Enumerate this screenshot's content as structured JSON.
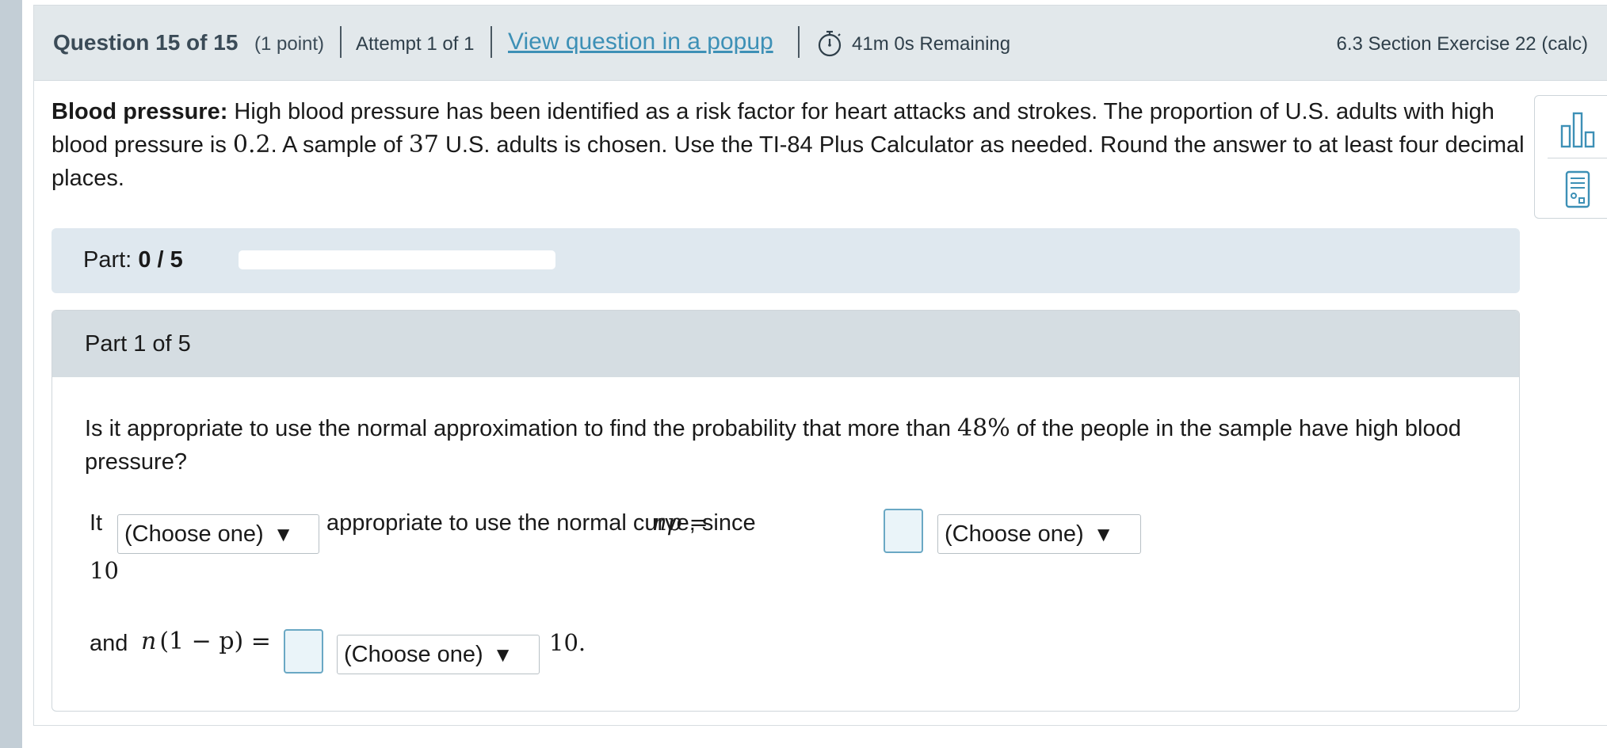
{
  "header": {
    "question_title": "Question 15 of 15",
    "points": "(1 point)",
    "attempt": "Attempt 1 of 1",
    "popup_link": "View question in a popup",
    "timer": "41m 0s Remaining",
    "section": "6.3 Section Exercise 22 (calc)"
  },
  "problem": {
    "bold_label": "Blood pressure:",
    "text1": " High blood pressure has been identified as a risk factor for heart attacks and strokes. The proportion of U.S. adults with high blood pressure is ",
    "p_value": "0.2",
    "text2": ". A sample of ",
    "n_value": "37",
    "text3": " U.S. adults is chosen. Use the TI-84 Plus Calculator as needed. Round the answer to at least four decimal places."
  },
  "tools": {
    "stats_icon": "bar-chart-icon",
    "calc_icon": "calculator-icon"
  },
  "part_progress": {
    "label": "Part: ",
    "value": "0 / 5",
    "fraction": 0
  },
  "part": {
    "title": "Part 1 of 5",
    "question_pre": "Is it appropriate to use the normal approximation to find the probability that more than ",
    "percent": "48%",
    "question_post": " of the people in the sample have high blood pressure?",
    "line1_it": "It",
    "select1": "(Choose one)",
    "line1_mid": "appropriate to use the normal curve, since",
    "np_label": "np =",
    "select2": "(Choose one)",
    "ten1": "10",
    "and_label": "and",
    "n1p_n": "n",
    "n1p_paren": "(1 − p) =",
    "select3": "(Choose one)",
    "ten2": "10.",
    "arrow": "▼"
  }
}
